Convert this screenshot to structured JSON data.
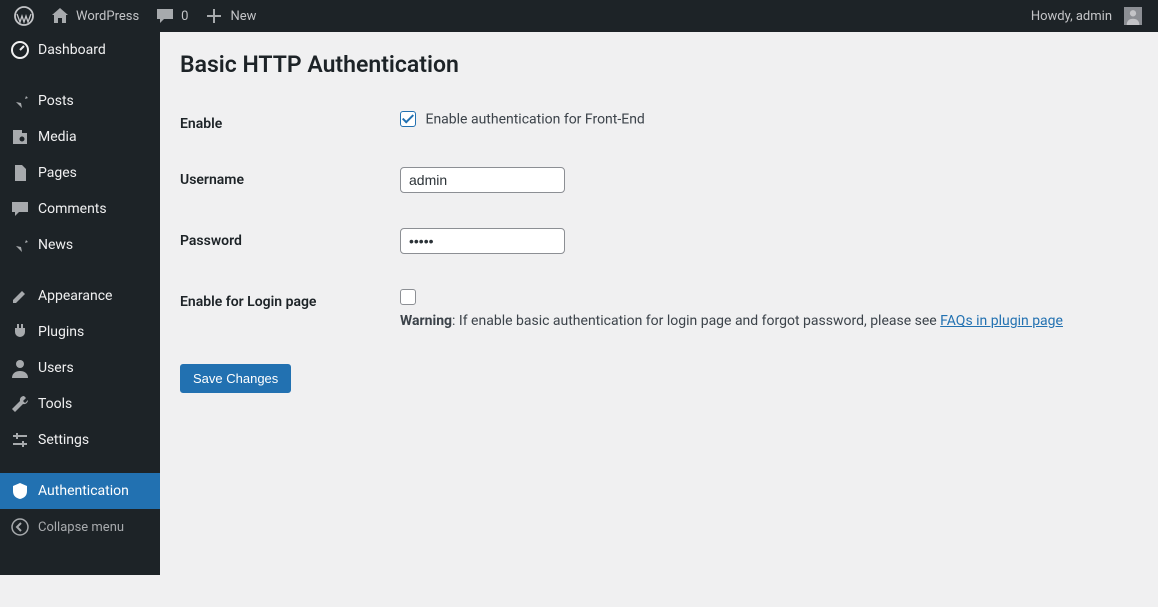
{
  "adminbar": {
    "site_name": "WordPress",
    "comments_count": "0",
    "new_label": "New",
    "howdy": "Howdy, admin"
  },
  "sidebar": {
    "items": [
      {
        "label": "Dashboard",
        "icon": "dashboard"
      },
      {
        "label": "Posts",
        "icon": "pin"
      },
      {
        "label": "Media",
        "icon": "media"
      },
      {
        "label": "Pages",
        "icon": "pages"
      },
      {
        "label": "Comments",
        "icon": "comment"
      },
      {
        "label": "News",
        "icon": "pin"
      },
      {
        "label": "Appearance",
        "icon": "appearance"
      },
      {
        "label": "Plugins",
        "icon": "plugin"
      },
      {
        "label": "Users",
        "icon": "user"
      },
      {
        "label": "Tools",
        "icon": "tools"
      },
      {
        "label": "Settings",
        "icon": "settings"
      },
      {
        "label": "Authentication",
        "icon": "shield"
      }
    ],
    "collapse_label": "Collapse menu"
  },
  "page": {
    "title": "Basic HTTP Authentication",
    "fields": {
      "enable": {
        "th": "Enable",
        "checkbox_label": "Enable authentication for Front-End",
        "checked": true
      },
      "username": {
        "th": "Username",
        "value": "admin"
      },
      "password": {
        "th": "Password",
        "value": "•••••"
      },
      "enable_login": {
        "th": "Enable for Login page",
        "checked": false,
        "warn_strong": "Warning",
        "warn_text": ": If enable basic authentication for login page and forgot password, please see ",
        "warn_link": "FAQs in plugin page"
      }
    },
    "submit_label": "Save Changes"
  }
}
